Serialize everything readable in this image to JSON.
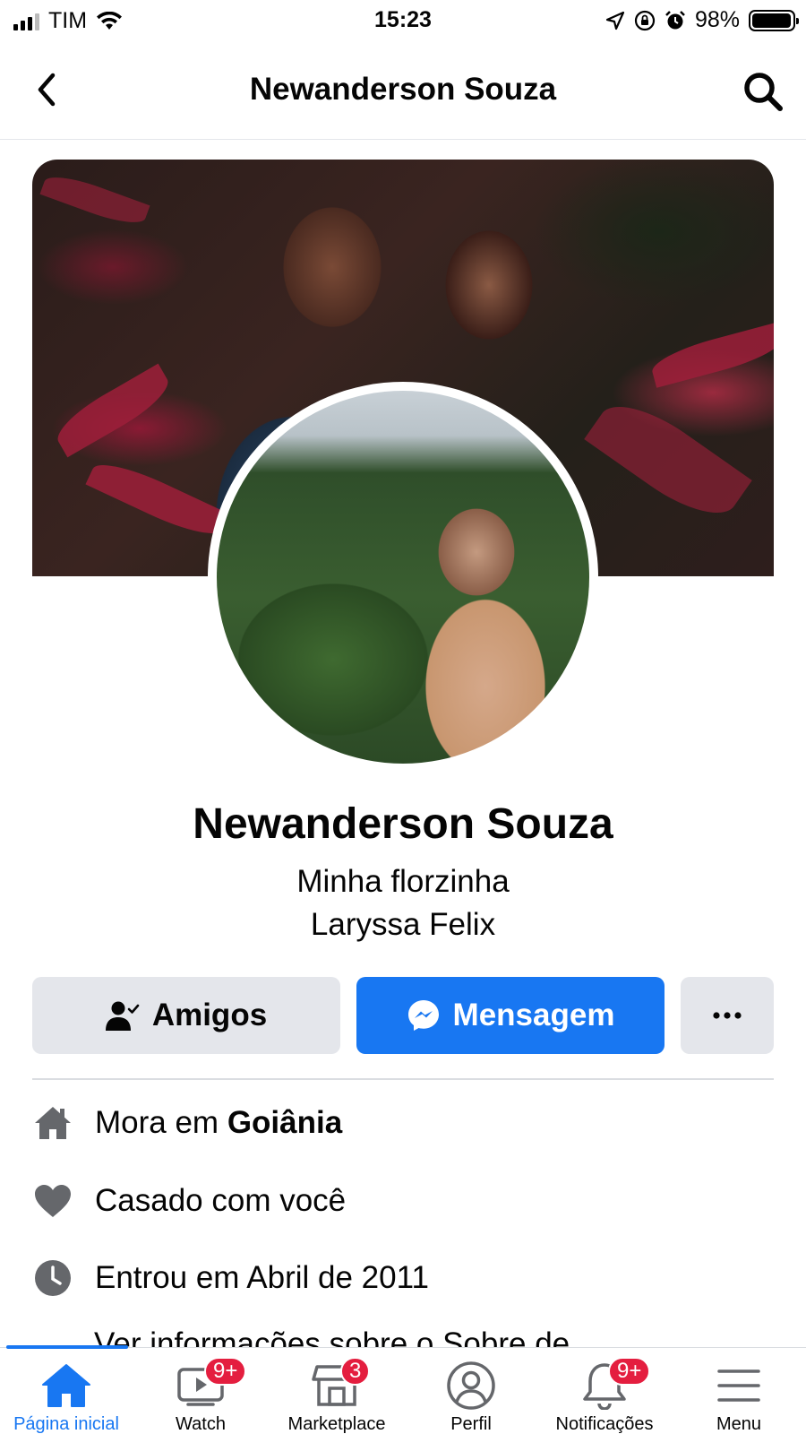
{
  "status_bar": {
    "carrier": "TIM",
    "time": "15:23",
    "battery": "98%",
    "battery_level": 0.98
  },
  "header": {
    "title": "Newanderson Souza"
  },
  "profile": {
    "name": "Newanderson Souza",
    "bio_line1": "Minha florzinha",
    "bio_line2": "Laryssa Felix"
  },
  "actions": {
    "friends_label": "Amigos",
    "message_label": "Mensagem",
    "more_label": "···"
  },
  "details": [
    {
      "icon": "home-icon",
      "prefix": "Mora em ",
      "bold": "Goiânia"
    },
    {
      "icon": "heart-icon",
      "prefix": "Casado com você",
      "bold": ""
    },
    {
      "icon": "clock-icon",
      "prefix": "Entrou em Abril de 2011",
      "bold": ""
    }
  ],
  "details_cut_text": "Ver informações sobre o Sobre de",
  "bottom_nav": {
    "items": [
      {
        "label": "Página inicial",
        "icon": "home-icon",
        "badge": "",
        "active": true
      },
      {
        "label": "Watch",
        "icon": "watch-icon",
        "badge": "9+",
        "active": false
      },
      {
        "label": "Marketplace",
        "icon": "marketplace-icon",
        "badge": "3",
        "active": false
      },
      {
        "label": "Perfil",
        "icon": "profile-icon",
        "badge": "",
        "active": false
      },
      {
        "label": "Notificações",
        "icon": "bell-icon",
        "badge": "9+",
        "active": false
      },
      {
        "label": "Menu",
        "icon": "menu-icon",
        "badge": "",
        "active": false
      }
    ]
  },
  "colors": {
    "accent": "#1877f2",
    "badge": "#e41e3f",
    "button_gray": "#e4e6eb",
    "icon_gray": "#65676b"
  }
}
